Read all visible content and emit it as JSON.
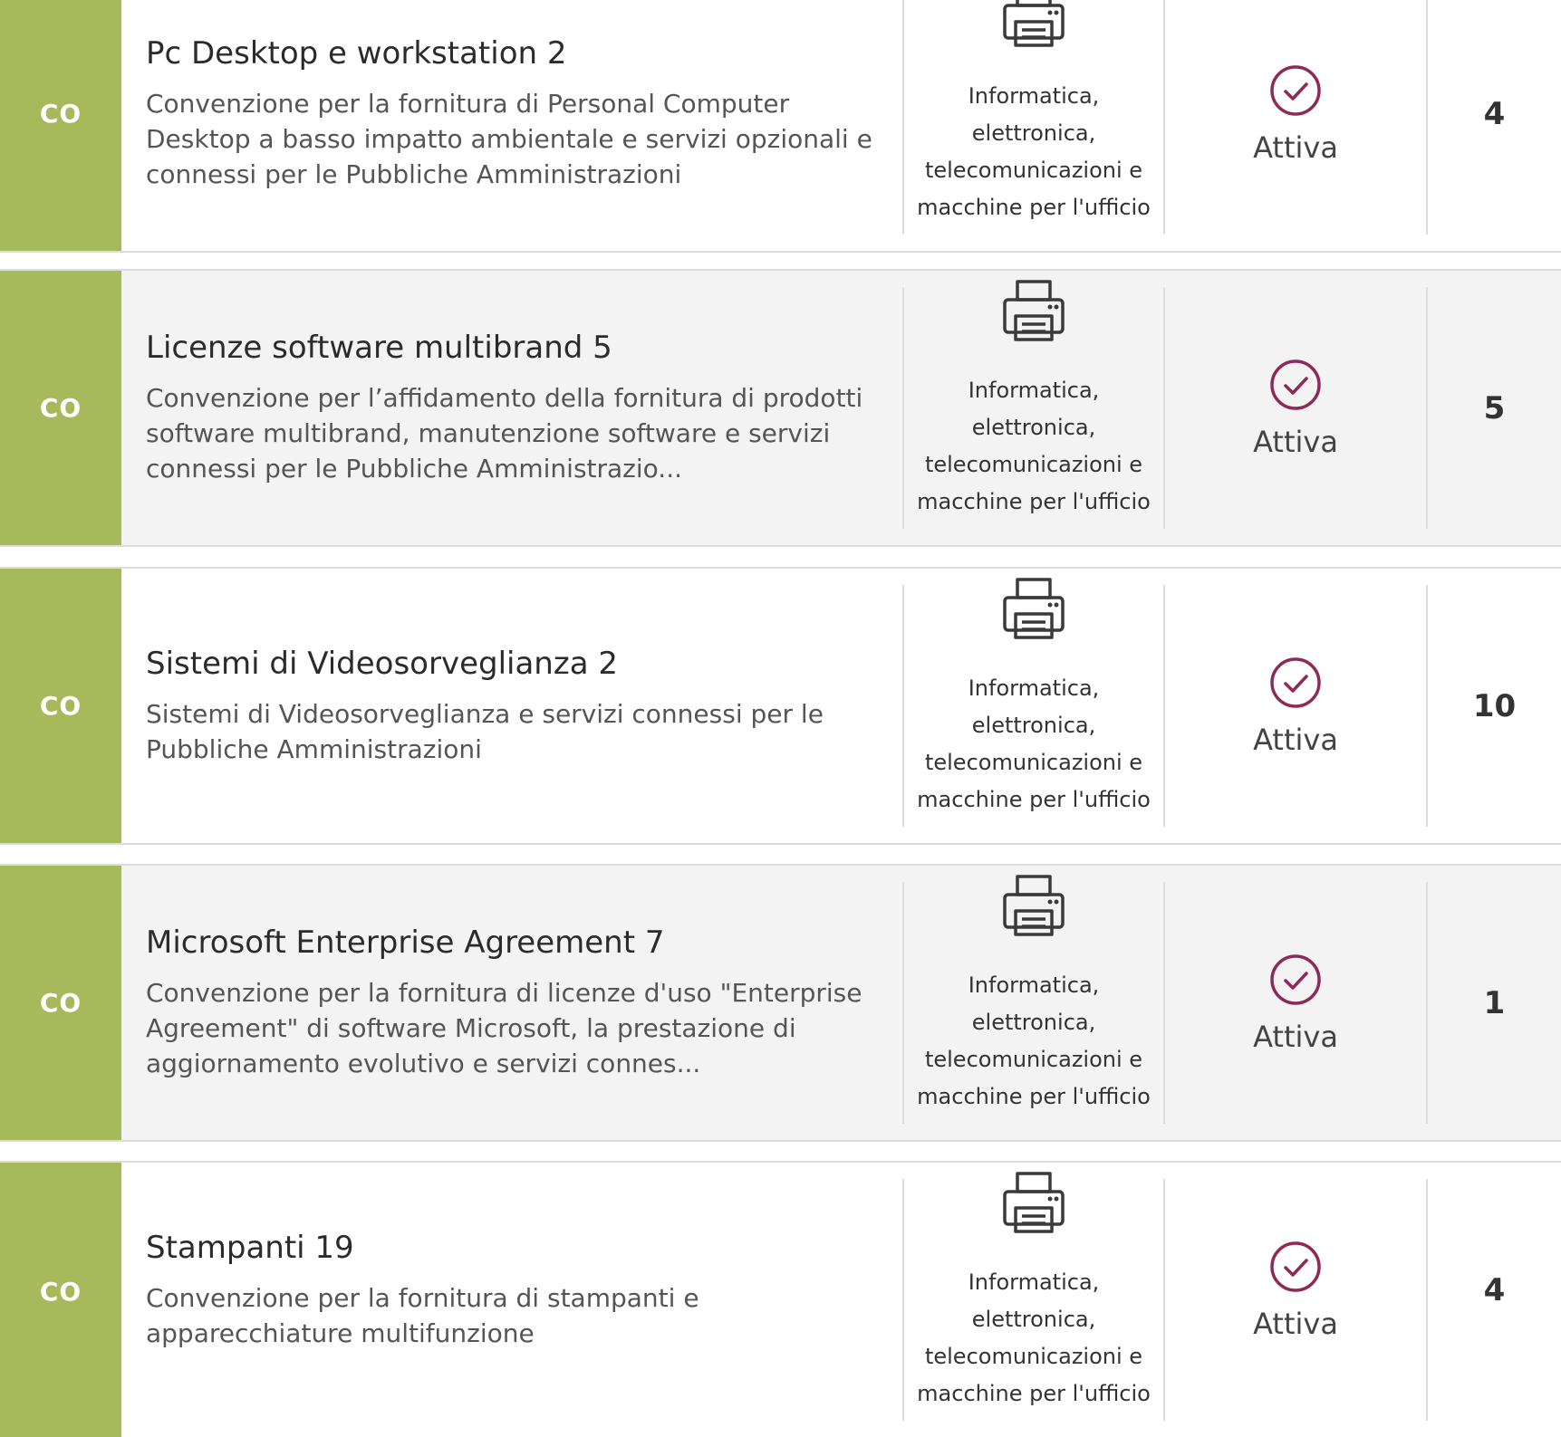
{
  "colors": {
    "type_bar": "#a6b95b",
    "status_icon": "#8e2a56"
  },
  "rows": [
    {
      "type": "CO",
      "title": "Pc Desktop e workstation 2",
      "description": "Convenzione per la fornitura di Personal Computer Desktop a basso impatto ambientale e servizi opzionali e connessi per le Pubbliche Amministrazioni",
      "category_icon": "printer-icon",
      "category": "Informatica, elettronica, telecomunicazioni e macchine per l'ufficio",
      "status_icon": "check-circle-icon",
      "status": "Attiva",
      "count": "4"
    },
    {
      "type": "CO",
      "title": "Licenze software multibrand 5",
      "description": "Convenzione per l’affidamento della fornitura di prodotti software multibrand, manutenzione software e servizi connessi per le Pubbliche Amministrazio...",
      "category_icon": "printer-icon",
      "category": "Informatica, elettronica, telecomunicazioni e macchine per l'ufficio",
      "status_icon": "check-circle-icon",
      "status": "Attiva",
      "count": "5"
    },
    {
      "type": "CO",
      "title": "Sistemi di Videosorveglianza 2",
      "description": "Sistemi di Videosorveglianza e servizi connessi per le Pubbliche Amministrazioni",
      "category_icon": "printer-icon",
      "category": "Informatica, elettronica, telecomunicazioni e macchine per l'ufficio",
      "status_icon": "check-circle-icon",
      "status": "Attiva",
      "count": "10"
    },
    {
      "type": "CO",
      "title": "Microsoft Enterprise Agreement 7",
      "description": "Convenzione per la fornitura di licenze d'uso \"Enterprise Agreement\" di software Microsoft, la prestazione di aggiornamento evolutivo e servizi connes...",
      "category_icon": "printer-icon",
      "category": "Informatica, elettronica, telecomunicazioni e macchine per l'ufficio",
      "status_icon": "check-circle-icon",
      "status": "Attiva",
      "count": "1"
    },
    {
      "type": "CO",
      "title": "Stampanti 19",
      "description": "Convenzione per la fornitura di stampanti e apparecchiature multifunzione",
      "category_icon": "printer-icon",
      "category": "Informatica, elettronica, telecomunicazioni e macchine per l'ufficio",
      "status_icon": "check-circle-icon",
      "status": "Attiva",
      "count": "4"
    }
  ]
}
